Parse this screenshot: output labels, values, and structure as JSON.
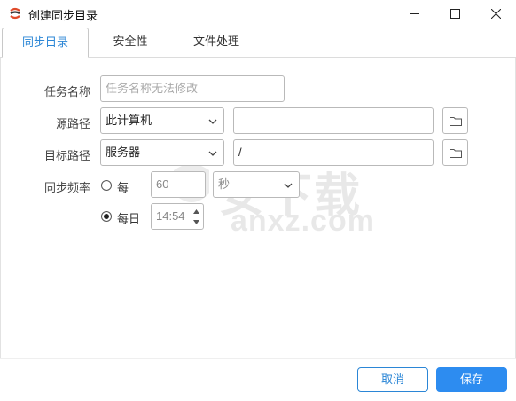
{
  "window": {
    "title": "创建同步目录",
    "app_icon": "sync-app-icon",
    "controls": [
      "minimize-icon",
      "maximize-icon",
      "close-icon"
    ]
  },
  "tabs": [
    {
      "label": "同步目录",
      "active": true
    },
    {
      "label": "安全性",
      "active": false
    },
    {
      "label": "文件处理",
      "active": false
    }
  ],
  "form": {
    "task_name": {
      "label": "任务名称",
      "placeholder": "任务名称无法修改",
      "value": ""
    },
    "source_path": {
      "label": "源路径",
      "type_value": "此计算机",
      "path_value": "",
      "browse_icon": "folder-icon"
    },
    "target_path": {
      "label": "目标路径",
      "type_value": "服务器",
      "path_value": "/",
      "browse_icon": "folder-icon"
    },
    "sync_frequency": {
      "label": "同步频率",
      "interval_option": {
        "label": "每",
        "selected": false,
        "amount": "60",
        "unit": "秒"
      },
      "daily_option": {
        "label": "每日",
        "selected": true,
        "time": "14:54"
      }
    }
  },
  "watermark": {
    "text": "安下载",
    "sub": "anxz.com"
  },
  "footer": {
    "cancel_label": "取消",
    "save_label": "保存"
  },
  "colors": {
    "accent": "#2D8CF0",
    "tab_active": "#2B86D6",
    "border": "#B9B9B9"
  }
}
